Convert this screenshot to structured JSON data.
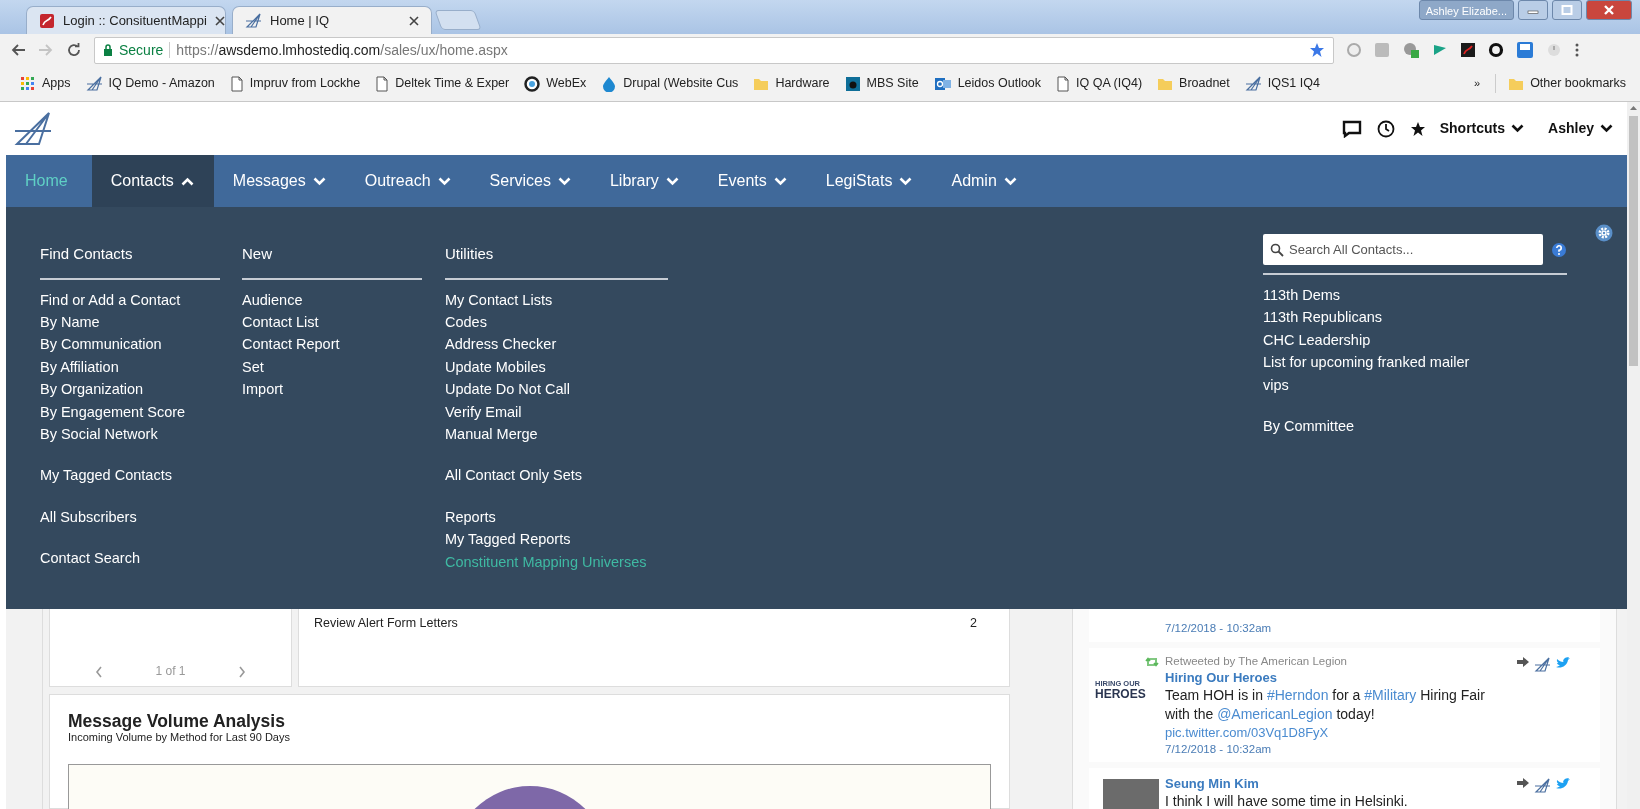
{
  "browser": {
    "tabs": [
      {
        "title": "Login :: ConsituentMappi",
        "selected": false
      },
      {
        "title": "Home | IQ",
        "selected": true
      }
    ],
    "profile": "Ashley Elizabe...",
    "forward": {
      "disabled": true
    },
    "address": {
      "secure_label": "Secure",
      "url_scheme": "https://",
      "url_host": "awsdemo.lmhostediq.com",
      "url_path": "/sales/ux/home.aspx"
    },
    "bookmarks": [
      {
        "label": "Apps"
      },
      {
        "label": "IQ Demo - Amazon"
      },
      {
        "label": "Impruv from Lockhe"
      },
      {
        "label": "Deltek Time & Exper"
      },
      {
        "label": "WebEx"
      },
      {
        "label": "Drupal (Website Cus"
      },
      {
        "label": "Hardware"
      },
      {
        "label": "MBS Site"
      },
      {
        "label": "Leidos Outlook"
      },
      {
        "label": "IQ QA (IQ4)"
      },
      {
        "label": "Broadnet"
      },
      {
        "label": "IQS1 IQ4"
      }
    ],
    "overflow": "»",
    "other_bookmarks": "Other bookmarks"
  },
  "header": {
    "shortcuts": "Shortcuts",
    "user": "Ashley"
  },
  "nav": [
    {
      "label": "Home",
      "selected": true,
      "expanded": false,
      "has_menu": false
    },
    {
      "label": "Contacts",
      "selected": false,
      "expanded": true,
      "has_menu": true
    },
    {
      "label": "Messages",
      "selected": false,
      "expanded": false,
      "has_menu": true
    },
    {
      "label": "Outreach",
      "selected": false,
      "expanded": false,
      "has_menu": true
    },
    {
      "label": "Services",
      "selected": false,
      "expanded": false,
      "has_menu": true
    },
    {
      "label": "Library",
      "selected": false,
      "expanded": false,
      "has_menu": true
    },
    {
      "label": "Events",
      "selected": false,
      "expanded": false,
      "has_menu": true
    },
    {
      "label": "LegiStats",
      "selected": false,
      "expanded": false,
      "has_menu": true
    },
    {
      "label": "Admin",
      "selected": false,
      "expanded": false,
      "has_menu": true
    }
  ],
  "menu": {
    "columns": [
      {
        "heading": "Find Contacts",
        "groups": [
          [
            {
              "label": "Find or Add a Contact",
              "selected": false
            },
            {
              "label": "By Name",
              "selected": false
            },
            {
              "label": "By Communication",
              "selected": false
            },
            {
              "label": "By Affiliation",
              "selected": false
            },
            {
              "label": "By Organization",
              "selected": false
            },
            {
              "label": "By Engagement Score",
              "selected": false
            },
            {
              "label": "By Social Network",
              "selected": false
            }
          ],
          [
            {
              "label": "My Tagged Contacts",
              "selected": false
            }
          ],
          [
            {
              "label": "All Subscribers",
              "selected": false
            }
          ],
          [
            {
              "label": "Contact Search",
              "selected": false
            }
          ]
        ]
      },
      {
        "heading": "New",
        "groups": [
          [
            {
              "label": "Audience",
              "selected": false
            },
            {
              "label": "Contact List",
              "selected": false
            },
            {
              "label": "Contact Report",
              "selected": false
            },
            {
              "label": "Set",
              "selected": false
            },
            {
              "label": "Import",
              "selected": false
            }
          ]
        ]
      },
      {
        "heading": "Utilities",
        "groups": [
          [
            {
              "label": "My Contact Lists",
              "selected": false
            },
            {
              "label": "Codes",
              "selected": false
            },
            {
              "label": "Address Checker",
              "selected": false
            },
            {
              "label": "Update Mobiles",
              "selected": false
            },
            {
              "label": "Update Do Not Call",
              "selected": false
            },
            {
              "label": "Verify Email",
              "selected": false
            },
            {
              "label": "Manual Merge",
              "selected": false
            }
          ],
          [
            {
              "label": "All Contact Only Sets",
              "selected": false
            }
          ],
          [
            {
              "label": "Reports",
              "selected": false
            },
            {
              "label": "My Tagged Reports",
              "selected": false
            },
            {
              "label": "Constituent Mapping Universes",
              "selected": true
            }
          ]
        ]
      }
    ],
    "search": {
      "placeholder": "Search All Contacts..."
    },
    "saved_lists": [
      [
        "113th Dems",
        "113th Republicans",
        "CHC Leadership",
        "List for upcoming franked mailer",
        "vips"
      ],
      [
        "By Committee"
      ]
    ]
  },
  "content": {
    "pager": "1 of 1",
    "tasks": [
      {
        "label": "Review Alert Form Letters",
        "count": "2"
      }
    ],
    "volume": {
      "title": "Message Volume Analysis",
      "subtitle": "Incoming Volume by Method for Last 90 Days"
    },
    "tweets": [
      {
        "kind": "cut",
        "time": "7/12/2018 - 10:32am"
      },
      {
        "kind": "retweet",
        "retweeted_by": "Retweeted by The American Legion",
        "avatar_lines": [
          "HIRING OUR",
          "HEROES"
        ],
        "author": "Hiring Our Heroes",
        "segments": [
          {
            "kind": "text",
            "text": "Team HOH is in "
          },
          {
            "kind": "link",
            "text": "#Herndon"
          },
          {
            "kind": "text",
            "text": " for a "
          },
          {
            "kind": "link",
            "text": "#Military"
          },
          {
            "kind": "text",
            "text": " Hiring Fair with the "
          },
          {
            "kind": "link",
            "text": "@AmericanLegion"
          },
          {
            "kind": "text",
            "text": " today!"
          }
        ],
        "media_link": "pic.twitter.com/03Vq1D8FyX",
        "time": "7/12/2018 - 10:32am"
      },
      {
        "kind": "tweet",
        "author": "Seung Min Kim",
        "segments": [
          {
            "kind": "text",
            "text": "I think I will have some time in Helsinki."
          }
        ]
      }
    ]
  }
}
